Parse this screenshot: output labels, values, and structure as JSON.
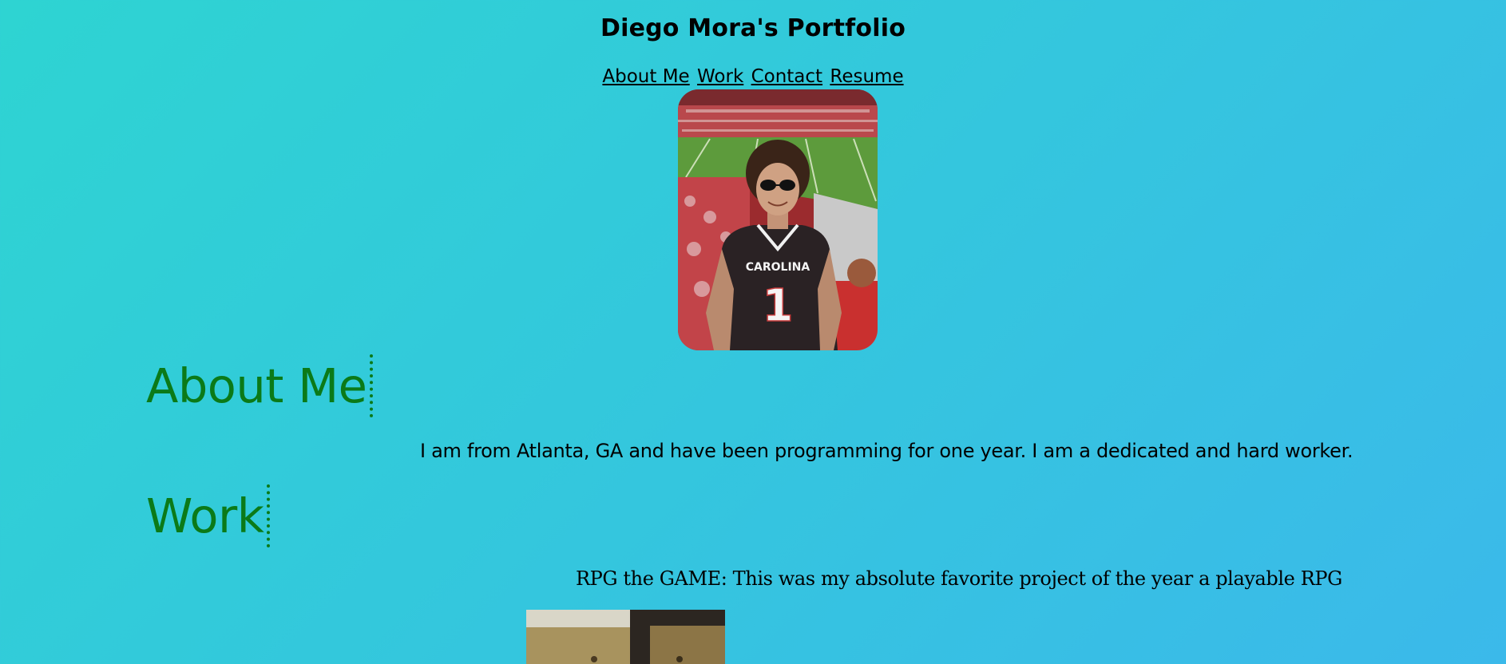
{
  "header": {
    "title": "Diego Mora's Portfolio"
  },
  "nav": {
    "items": [
      "About Me",
      "Work",
      "Contact",
      "Resume"
    ]
  },
  "profile": {
    "photo_icon": "profile-photo",
    "jersey_text": "CAROLINA",
    "jersey_number": "1"
  },
  "about": {
    "heading": "About Me",
    "text": "I am from Atlanta, GA and have been programming for one year. I am a dedicated and hard worker."
  },
  "work": {
    "heading": "Work",
    "project_text": "RPG the GAME: This was my absolute favorite project of the year a playable RPG"
  },
  "colors": {
    "heading": "#0b7a18",
    "background_start": "#2ed4d2",
    "background_end": "#3bb9ea"
  }
}
